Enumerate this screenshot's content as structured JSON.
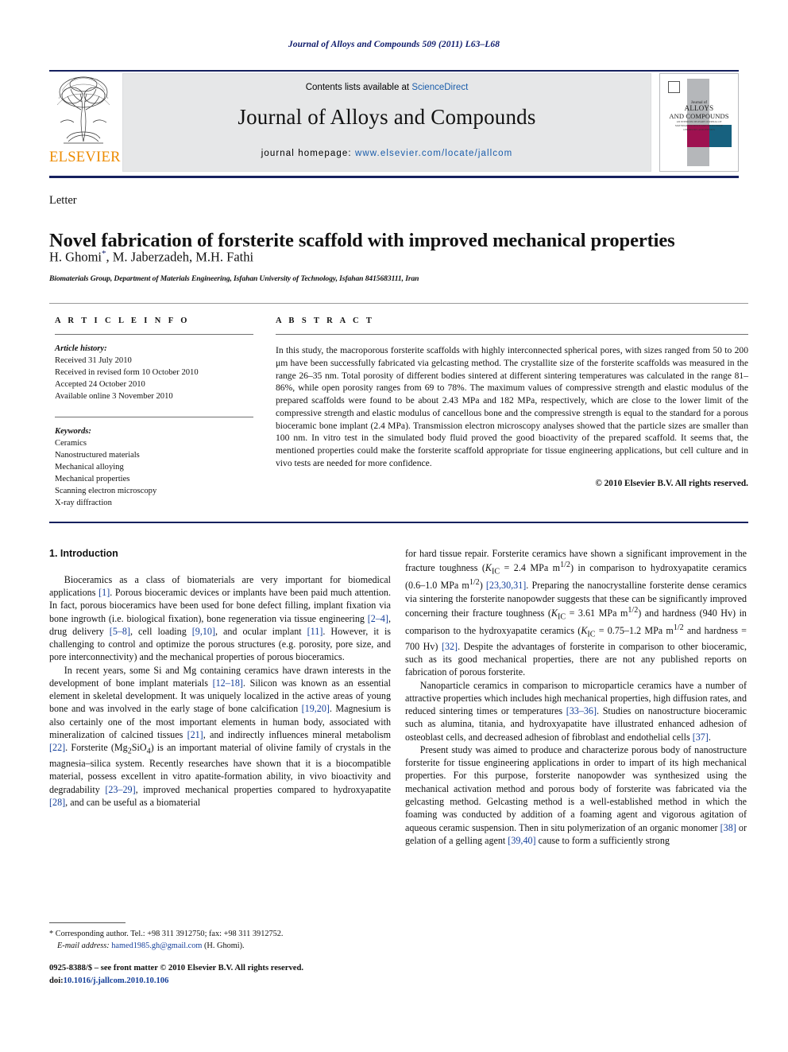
{
  "running_head": "Journal of Alloys and Compounds 509 (2011) L63–L68",
  "masthead": {
    "contents_prefix": "Contents lists available at ",
    "sciencedirect": "ScienceDirect",
    "journal_name": "Journal of Alloys and Compounds",
    "homepage_label": "journal homepage: ",
    "homepage_url": "www.elsevier.com/locate/jallcom",
    "publisher": "ELSEVIER",
    "cover": {
      "line1": "Journal of",
      "line2": "ALLOYS",
      "line3": "AND COMPOUNDS",
      "subtitle": "AN INTERDISCIPLINARY JOURNAL OF MATERIALS SCIENCE AND SOLID-STATE CHEMISTRY AND PHYSICS",
      "accent_magenta": "#9e1150",
      "accent_teal": "#17617f"
    }
  },
  "article": {
    "doc_type": "Letter",
    "title": "Novel fabrication of forsterite scaffold with improved mechanical properties",
    "authors": "H. Ghomi*, M. Jaberzadeh, M.H. Fathi",
    "affiliation": "Biomaterials Group, Department of Materials Engineering, Isfahan University of Technology, Isfahan 8415683111, Iran"
  },
  "info": {
    "heading": "A R T I C L E   I N F O",
    "history_label": "Article history:",
    "history": [
      "Received 31 July 2010",
      "Received in revised form 10 October 2010",
      "Accepted 24 October 2010",
      "Available online 3 November 2010"
    ],
    "keywords_label": "Keywords:",
    "keywords": [
      "Ceramics",
      "Nanostructured materials",
      "Mechanical alloying",
      "Mechanical properties",
      "Scanning electron microscopy",
      "X-ray diffraction"
    ]
  },
  "abstract": {
    "heading": "A B S T R A C T",
    "text": "In this study, the macroporous forsterite scaffolds with highly interconnected spherical pores, with sizes ranged from 50 to 200 μm have been successfully fabricated via gelcasting method. The crystallite size of the forsterite scaffolds was measured in the range 26–35 nm. Total porosity of different bodies sintered at different sintering temperatures was calculated in the range 81–86%, while open porosity ranges from 69 to 78%. The maximum values of compressive strength and elastic modulus of the prepared scaffolds were found to be about 2.43 MPa and 182 MPa, respectively, which are close to the lower limit of the compressive strength and elastic modulus of cancellous bone and the compressive strength is equal to the standard for a porous bioceramic bone implant (2.4 MPa). Transmission electron microscopy analyses showed that the particle sizes are smaller than 100 nm. In vitro test in the simulated body fluid proved the good bioactivity of the prepared scaffold. It seems that, the mentioned properties could make the forsterite scaffold appropriate for tissue engineering applications, but cell culture and in vivo tests are needed for more confidence.",
    "copyright": "© 2010 Elsevier B.V. All rights reserved."
  },
  "body": {
    "section_heading": "1.  Introduction",
    "left_paragraphs": [
      "Bioceramics as a class of biomaterials are very important for biomedical applications [1]. Porous bioceramic devices or implants have been paid much attention. In fact, porous bioceramics have been used for bone defect filling, implant fixation via bone ingrowth (i.e. biological fixation), bone regeneration via tissue engineering [2–4], drug delivery [5–8], cell loading [9,10], and ocular implant [11]. However, it is challenging to control and optimize the porous structures (e.g. porosity, pore size, and pore interconnectivity) and the mechanical properties of porous bioceramics.",
      "In recent years, some Si and Mg containing ceramics have drawn interests in the development of bone implant materials [12–18]. Silicon was known as an essential element in skeletal development. It was uniquely localized in the active areas of young bone and was involved in the early stage of bone calcification [19,20]. Magnesium is also certainly one of the most important elements in human body, associated with mineralization of calcined tissues [21], and indirectly influences mineral metabolism [22]. Forsterite (Mg2SiO4) is an important material of olivine family of crystals in the magnesia–silica system. Recently researches have shown that it is a biocompatible material, possess excellent in vitro apatite-formation ability, in vivo bioactivity and degradability [23–29], improved mechanical properties compared to hydroxyapatite [28], and can be useful as a biomaterial"
    ],
    "right_paragraphs": [
      "for hard tissue repair. Forsterite ceramics have shown a significant improvement in the fracture toughness (KIC = 2.4 MPa m1/2) in comparison to hydroxyapatite ceramics (0.6–1.0 MPa m1/2) [23,30,31]. Preparing the nanocrystalline forsterite dense ceramics via sintering the forsterite nanopowder suggests that these can be significantly improved concerning their fracture toughness (KIC = 3.61 MPa m1/2) and hardness (940 Hv) in comparison to the hydroxyapatite ceramics (KIC = 0.75–1.2 MPa m1/2 and hardness = 700 Hv) [32]. Despite the advantages of forsterite in comparison to other bioceramic, such as its good mechanical properties, there are not any published reports on fabrication of porous forsterite.",
      "Nanoparticle ceramics in comparison to microparticle ceramics have a number of attractive properties which includes high mechanical properties, high diffusion rates, and reduced sintering times or temperatures [33–36]. Studies on nanostructure bioceramic such as alumina, titania, and hydroxyapatite have illustrated enhanced adhesion of osteoblast cells, and decreased adhesion of fibroblast and endothelial cells [37].",
      "Present study was aimed to produce and characterize porous body of nanostructure forsterite for tissue engineering applications in order to impart of its high mechanical properties. For this purpose, forsterite nanopowder was synthesized using the mechanical activation method and porous body of forsterite was fabricated via the gelcasting method. Gelcasting method is a well-established method in which the foaming was conducted by addition of a foaming agent and vigorous agitation of aqueous ceramic suspension. Then in situ polymerization of an organic monomer [38] or gelation of a gelling agent [39,40] cause to form a sufficiently strong"
    ]
  },
  "footer": {
    "corresponding": "* Corresponding author. Tel.: +98 311 3912750; fax: +98 311 3912752.",
    "email_label": "E-mail address: ",
    "email": "hamed1985.gh@gmail.com",
    "email_suffix": " (H. Ghomi).",
    "front_matter": "0925-8388/$ – see front matter © 2010 Elsevier B.V. All rights reserved.",
    "doi_label": "doi:",
    "doi": "10.1016/j.jallcom.2010.10.106"
  }
}
